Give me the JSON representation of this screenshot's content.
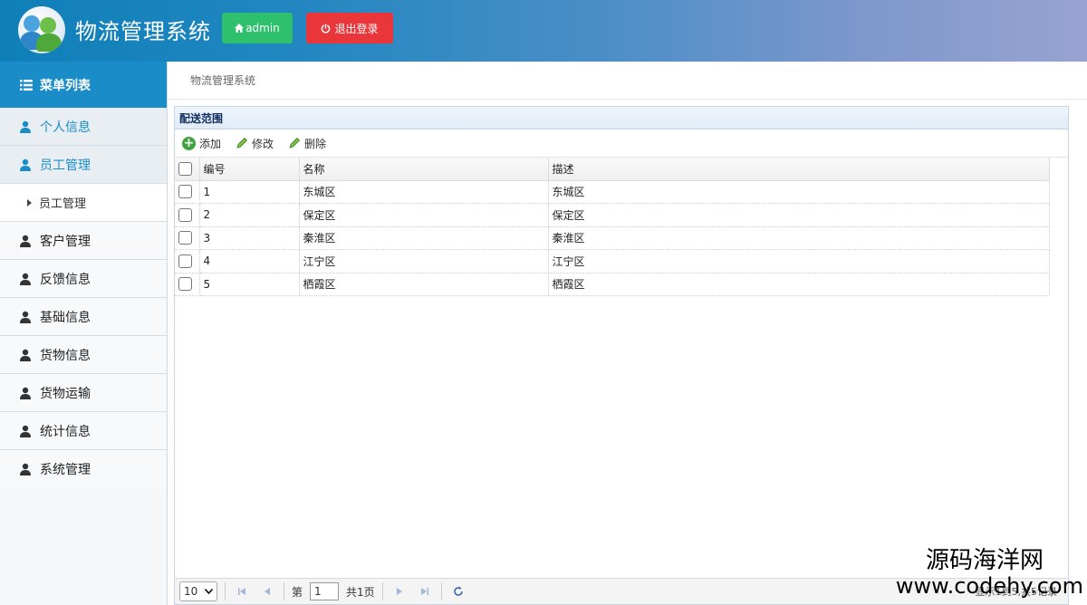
{
  "header": {
    "app_title": "物流管理系统",
    "user_button": "admin",
    "logout_button": "退出登录",
    "colors": {
      "admin_btn": "#2ec06c",
      "logout_btn": "#e8363b"
    }
  },
  "sidebar": {
    "title": "菜单列表",
    "items": [
      {
        "label": "个人信息"
      },
      {
        "label": "员工管理"
      },
      {
        "label": "员工管理"
      },
      {
        "label": "客户管理"
      },
      {
        "label": "反馈信息"
      },
      {
        "label": "基础信息"
      },
      {
        "label": "货物信息"
      },
      {
        "label": "货物运输"
      },
      {
        "label": "统计信息"
      },
      {
        "label": "系统管理"
      }
    ],
    "accent_color": "#1a8dc8"
  },
  "breadcrumb": "物流管理系统",
  "panel": {
    "title": "配送范围",
    "toolbar": {
      "add": "添加",
      "edit": "修改",
      "delete": "删除"
    },
    "columns": [
      "编号",
      "名称",
      "描述"
    ],
    "rows": [
      [
        "1",
        "东城区",
        "东城区"
      ],
      [
        "2",
        "保定区",
        "保定区"
      ],
      [
        "3",
        "秦淮区",
        "秦淮区"
      ],
      [
        "4",
        "江宁区",
        "江宁区"
      ],
      [
        "5",
        "栖霞区",
        "栖霞区"
      ]
    ]
  },
  "pager": {
    "page_size": "10",
    "page_prefix": "第",
    "current_page": "1",
    "total_pages": "共1页",
    "info": "显示1到5,共5记录"
  },
  "watermark": {
    "line1": "源码海洋网",
    "line2": "www.codehy.com"
  }
}
